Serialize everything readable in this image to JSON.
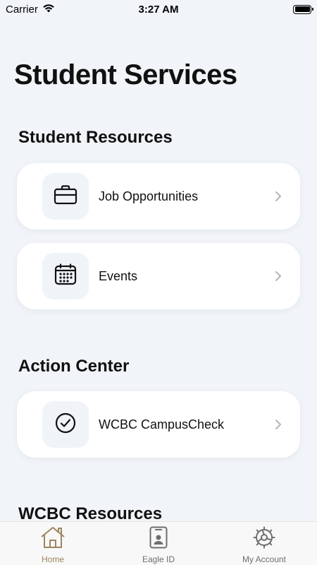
{
  "status_bar": {
    "carrier": "Carrier",
    "time": "3:27 AM"
  },
  "page": {
    "title": "Student Services"
  },
  "sections": [
    {
      "title": "Student Resources",
      "items": [
        {
          "label": "Job Opportunities",
          "icon": "briefcase-icon"
        },
        {
          "label": "Events",
          "icon": "calendar-icon"
        }
      ]
    },
    {
      "title": "Action Center",
      "items": [
        {
          "label": "WCBC CampusCheck",
          "icon": "checkmark-circle-icon"
        }
      ]
    },
    {
      "title": "WCBC Resources",
      "items": []
    }
  ],
  "tab_bar": {
    "tabs": [
      {
        "label": "Home",
        "icon": "home-icon",
        "active": true
      },
      {
        "label": "Eagle ID",
        "icon": "id-card-icon",
        "active": false
      },
      {
        "label": "My Account",
        "icon": "gear-icon",
        "active": false
      }
    ]
  },
  "colors": {
    "background": "#f1f4f8",
    "card": "#ffffff",
    "accent": "#9c8560",
    "inactive": "#6e6e6e"
  }
}
